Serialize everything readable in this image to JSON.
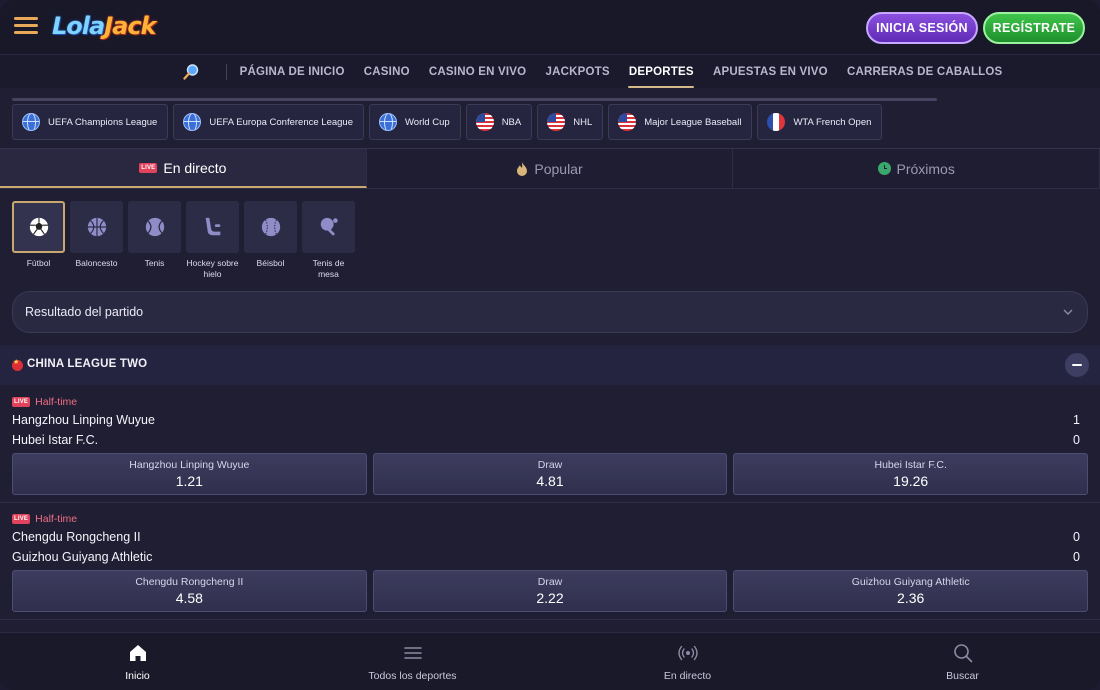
{
  "header": {
    "logo_part1": "Lola",
    "logo_part2": "Jack",
    "login_label": "INICIA SESIÓN",
    "register_label": "REGÍSTRATE"
  },
  "nav": {
    "items": [
      {
        "label": "PÁGINA DE INICIO",
        "active": false
      },
      {
        "label": "CASINO",
        "active": false
      },
      {
        "label": "CASINO EN VIVO",
        "active": false
      },
      {
        "label": "JACKPOTS",
        "active": false
      },
      {
        "label": "DEPORTES",
        "active": true
      },
      {
        "label": "APUESTAS EN VIVO",
        "active": false
      },
      {
        "label": "CARRERAS DE CABALLOS",
        "active": false
      }
    ]
  },
  "leagues": [
    {
      "label": "UEFA Champions League",
      "icon": "globe"
    },
    {
      "label": "UEFA Europa Conference League",
      "icon": "globe"
    },
    {
      "label": "World Cup",
      "icon": "globe"
    },
    {
      "label": "NBA",
      "icon": "us"
    },
    {
      "label": "NHL",
      "icon": "us"
    },
    {
      "label": "Major League Baseball",
      "icon": "us"
    },
    {
      "label": "WTA French Open",
      "icon": "fr"
    }
  ],
  "tabs": {
    "live_badge": "LIVE",
    "live": "En directo",
    "popular": "Popular",
    "upcoming": "Próximos"
  },
  "sports": [
    {
      "label": "Fútbol",
      "icon": "soccer-ball-icon",
      "active": true
    },
    {
      "label": "Baloncesto",
      "icon": "basketball-icon",
      "active": false
    },
    {
      "label": "Tenis",
      "icon": "tennis-ball-icon",
      "active": false
    },
    {
      "label": "Hockey sobre hielo",
      "icon": "hockey-stick-icon",
      "active": false
    },
    {
      "label": "Béisbol",
      "icon": "baseball-icon",
      "active": false
    },
    {
      "label": "Tenis de mesa",
      "icon": "table-tennis-icon",
      "active": false
    }
  ],
  "market_select": {
    "value": "Resultado del partido"
  },
  "league_section": {
    "name": "CHINA LEAGUE TWO"
  },
  "events": [
    {
      "status": "Half-time",
      "home": "Hangzhou Linping Wuyue",
      "away": "Hubei Istar F.C.",
      "home_score": "1",
      "away_score": "0",
      "odds": [
        {
          "label": "Hangzhou Linping Wuyue",
          "value": "1.21"
        },
        {
          "label": "Draw",
          "value": "4.81"
        },
        {
          "label": "Hubei Istar F.C.",
          "value": "19.26"
        }
      ]
    },
    {
      "status": "Half-time",
      "home": "Chengdu Rongcheng II",
      "away": "Guizhou Guiyang Athletic",
      "home_score": "0",
      "away_score": "0",
      "odds": [
        {
          "label": "Chengdu Rongcheng II",
          "value": "4.58"
        },
        {
          "label": "Draw",
          "value": "2.22"
        },
        {
          "label": "Guizhou Guiyang Athletic",
          "value": "2.36"
        }
      ]
    }
  ],
  "bottom_nav": [
    {
      "label": "Inicio",
      "icon": "home-icon",
      "active": true
    },
    {
      "label": "Todos los deportes",
      "icon": "list-icon",
      "active": false
    },
    {
      "label": "En directo",
      "icon": "broadcast-icon",
      "active": false
    },
    {
      "label": "Buscar",
      "icon": "search-icon",
      "active": false
    }
  ],
  "colors": {
    "accent_gold": "#c8a86e",
    "login_purple": "#7a3fd0",
    "register_green": "#2fb03d",
    "live_red": "#e0435b"
  }
}
